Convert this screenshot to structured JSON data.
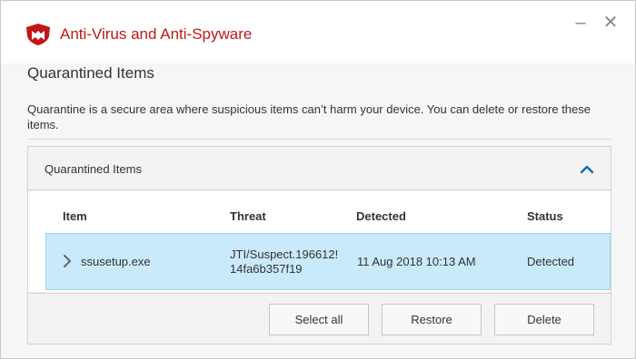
{
  "app": {
    "title": "Anti-Virus and Anti-Spyware",
    "brand_color": "#c01818",
    "logo_icon": "mcafee-shield-icon"
  },
  "window_controls": {
    "minimize_glyph": "–",
    "close_glyph": "✕"
  },
  "page": {
    "heading": "Quarantined Items",
    "description": "Quarantine is a secure area where suspicious items can’t harm your device. You can delete or restore these items."
  },
  "panel": {
    "title": "Quarantined Items",
    "collapse_icon": "chevron-up-icon",
    "accent_color": "#0a6fb5",
    "columns": [
      "Item",
      "Threat",
      "Detected",
      "Status"
    ],
    "rows": [
      {
        "item": "ssusetup.exe",
        "threat": "JTI/Suspect.196612! 14fa6b357f19",
        "detected": "11 Aug 2018 10:13 AM",
        "status": "Detected",
        "selected": true,
        "expand_icon": "chevron-right-icon"
      }
    ],
    "selected_row_color": "#c9eafb"
  },
  "actions": {
    "select_all": "Select all",
    "restore": "Restore",
    "delete": "Delete"
  }
}
